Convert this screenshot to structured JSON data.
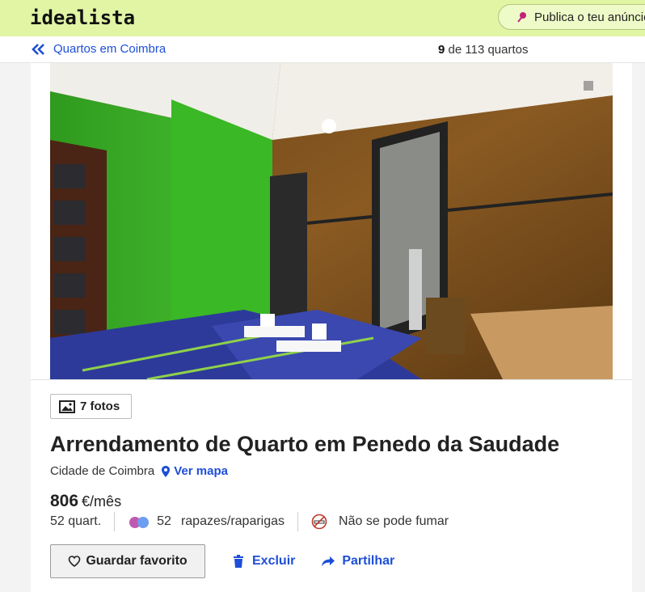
{
  "header": {
    "logo": "idealista",
    "publish_label": "Publica o teu anúncio"
  },
  "nav": {
    "back_label": "Quartos em Coimbra",
    "counter_current": "9",
    "counter_rest": "de 113 quartos"
  },
  "listing": {
    "photos_label": "7 fotos",
    "title": "Arrendamento de Quarto em Penedo da Saudade",
    "location": "Cidade de Coimbra",
    "map_label": "Ver mapa",
    "price_value": "806",
    "price_unit": "€/mês",
    "rooms": "52 quart.",
    "tenants_count": "52",
    "tenants_label": "rapazes/raparigas",
    "smoking": "Não se pode fumar"
  },
  "actions": {
    "favorite_label": "Guardar favorito",
    "exclude_label": "Excluir",
    "share_label": "Partilhar"
  },
  "colors": {
    "header_bg": "#e1f5a5",
    "link": "#1d4ed8",
    "wall_green": "#3fb52b"
  },
  "icons": [
    "pin-icon",
    "double-chevron-left-icon",
    "image-icon",
    "location-pin-icon",
    "people-dots-icon",
    "no-smoking-icon",
    "heart-icon",
    "trash-icon",
    "share-arrow-icon"
  ]
}
